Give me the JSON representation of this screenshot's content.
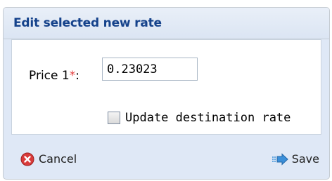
{
  "dialog": {
    "title": "Edit selected new rate"
  },
  "form": {
    "price_label": "Price 1",
    "required_marker": "*",
    "price_colon": ":",
    "price_value": "0.23023",
    "checkbox_label": "Update destination rate",
    "checkbox_checked": false
  },
  "footer": {
    "cancel_label": "Cancel",
    "save_label": "Save"
  },
  "icons": {
    "cancel": "cancel-icon",
    "save": "save-arrow-icon"
  },
  "colors": {
    "title": "#15428b",
    "required": "#e53a3a",
    "cancel_icon": "#d93b3b",
    "save_icon": "#3b8fd9"
  }
}
